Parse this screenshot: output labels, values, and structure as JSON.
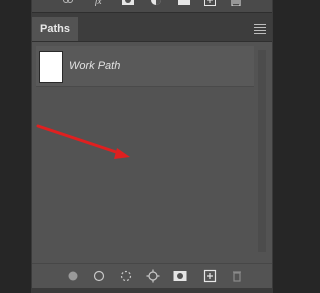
{
  "panel": {
    "tab_label": "Paths"
  },
  "paths": [
    {
      "label": "Work Path"
    }
  ],
  "icons": {
    "top": [
      "link-icon",
      "fx-icon",
      "mask-icon",
      "adjustment-icon",
      "folder-icon",
      "new-layer-icon",
      "trash-icon"
    ],
    "bottom": [
      "fill-path-icon",
      "stroke-path-icon",
      "load-selection-icon",
      "make-work-path-icon",
      "add-mask-icon",
      "new-path-icon",
      "delete-path-icon"
    ]
  },
  "colors": {
    "panel_bg": "#535353",
    "annotation_arrow": "#e02020"
  }
}
